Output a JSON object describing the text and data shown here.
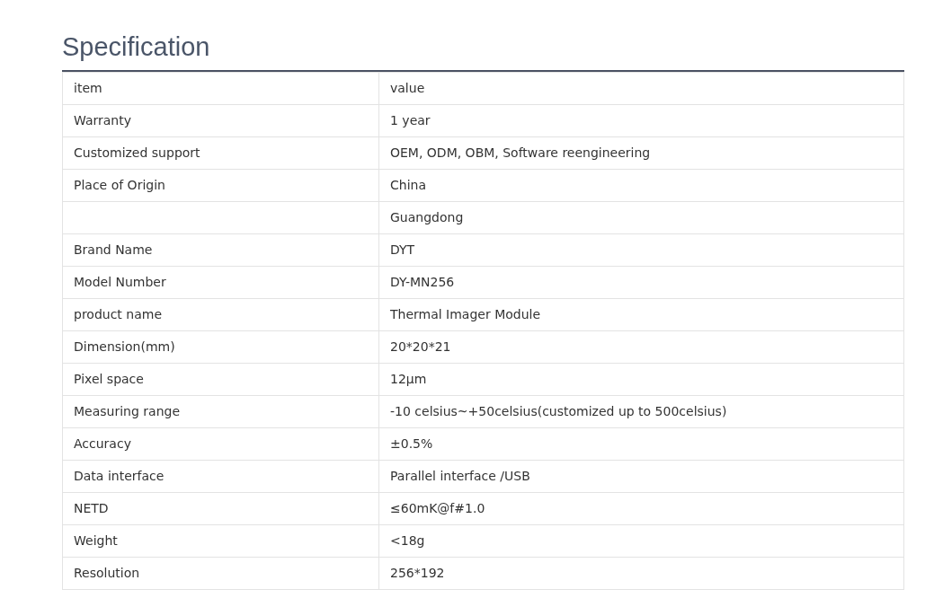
{
  "heading": "Specification",
  "table": {
    "rows": [
      [
        "item",
        "value"
      ],
      [
        "Warranty",
        "1 year"
      ],
      [
        "Customized support",
        "OEM, ODM, OBM, Software reengineering"
      ],
      [
        "Place of Origin",
        "China"
      ],
      [
        "",
        "Guangdong"
      ],
      [
        "Brand Name",
        "DYT"
      ],
      [
        "Model Number",
        "DY-MN256"
      ],
      [
        "product name",
        "Thermal Imager Module"
      ],
      [
        "Dimension(mm)",
        "20*20*21"
      ],
      [
        "Pixel space",
        "12μm"
      ],
      [
        "Measuring range",
        "-10 celsius~+50celsius(customized up to 500celsius)"
      ],
      [
        "Accuracy",
        "±0.5%"
      ],
      [
        "Data interface",
        "Parallel interface /USB"
      ],
      [
        "NETD",
        "≤60mK@f#1.0"
      ],
      [
        "Weight",
        "<18g"
      ],
      [
        "Resolution",
        "256*192"
      ]
    ]
  }
}
